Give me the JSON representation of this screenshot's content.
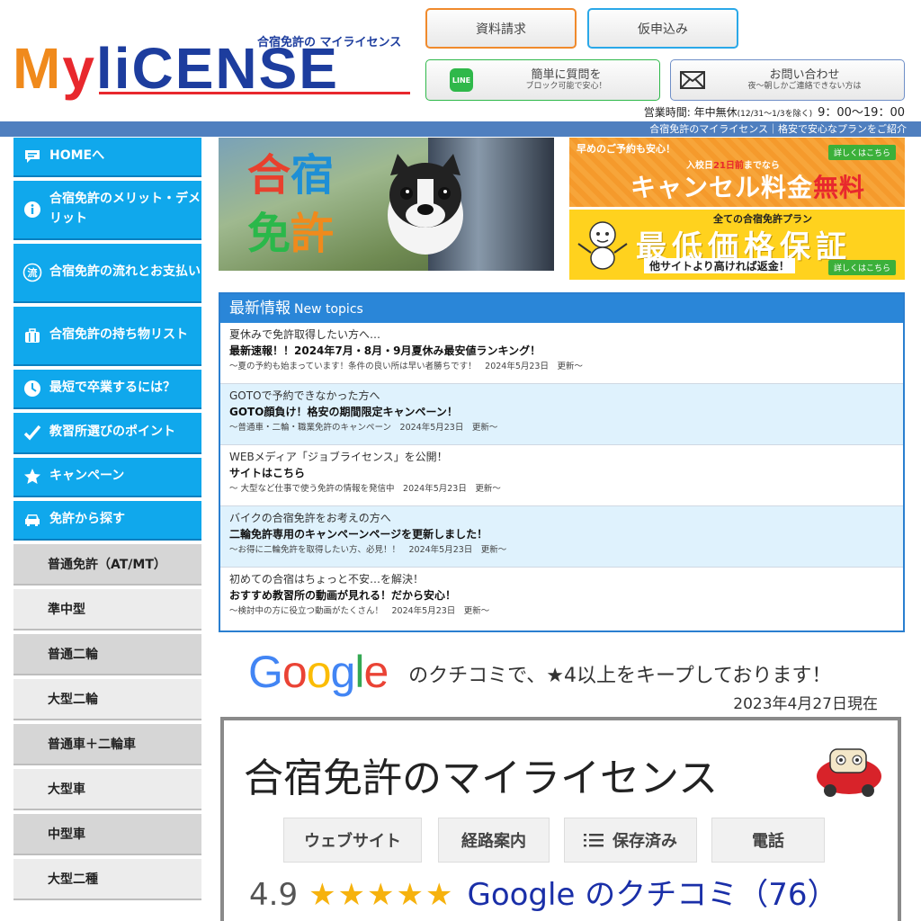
{
  "header": {
    "logo_subtitle": "合宿免許の マイライセンス",
    "logo_m": "M",
    "logo_y": "y",
    "logo_rest": "liCENSE",
    "buttons": {
      "document_request": "資料請求",
      "provisional_apply": "仮申込み",
      "line_main": "簡単に質問を",
      "line_sub": "ブロック可能で安心！",
      "line_icon_text": "LINE",
      "contact_main": "お問い合わせ",
      "contact_sub": "夜～朝しかご連絡できない方は"
    },
    "hours_label": "営業時間: 年中無休",
    "hours_note": "(12/31～1/3を除く)",
    "hours_time": "9：00～19：00",
    "tagline": "合宿免許のマイライセンス｜格安で安心なプランをご紹介"
  },
  "sidebar": {
    "blue_items": [
      {
        "label": "HOMEへ",
        "icon": "speech-bubble-icon"
      },
      {
        "label": "合宿免許のメリット・デメリット",
        "icon": "info-icon"
      },
      {
        "label": "合宿免許の流れとお支払い",
        "icon": "flow-icon",
        "icon_text": "流"
      },
      {
        "label": "合宿免許の持ち物リスト",
        "icon": "suitcase-icon"
      },
      {
        "label": "最短で卒業するには？",
        "icon": "clock-icon"
      },
      {
        "label": "教習所選びのポイント",
        "icon": "check-icon"
      },
      {
        "label": "キャンペーン",
        "icon": "star-icon"
      },
      {
        "label": "免許から探す",
        "icon": "car-icon"
      }
    ],
    "gray_items": [
      "普通免許（AT/MT）",
      "準中型",
      "普通二輪",
      "大型二輪",
      "普通車＋二輪車",
      "大型車",
      "中型車",
      "大型二種"
    ]
  },
  "hero": {
    "line1_a": "合",
    "line1_b": "宿",
    "line2_a": "免",
    "line2_b": "許"
  },
  "banner_cancel": {
    "top": "早めのご予約も安心！",
    "mid_prefix": "入校日",
    "mid_days": "21日前",
    "mid_suffix": "までなら",
    "big": "キャンセル料金",
    "big_accent": "無料",
    "detail": "詳しくはこちら"
  },
  "banner_price": {
    "top": "全ての合宿免許プラン",
    "big": "最低価格保証",
    "sub": "他サイトより高ければ返金！",
    "detail": "詳しくはこちら"
  },
  "topics": {
    "heading": "最新情報",
    "heading_en": "New topics",
    "items": [
      {
        "intro": "夏休みで免許取得したい方へ…",
        "title": "最新速報！！2024年7月・8月・9月夏休み最安値ランキング！",
        "meta": "～夏の予約も始まっています！条件の良い所は早い者勝ちです！　2024年5月23日　更新～"
      },
      {
        "intro": "GOTOで予約できなかった方へ",
        "title": "GOTO顔負け！格安の期間限定キャンペーン！",
        "meta": "～普通車・二輪・職業免許のキャンペーン　2024年5月23日　更新～"
      },
      {
        "intro": "WEBメディア「ジョブライセンス」を公開！",
        "title": "サイトはこちら",
        "meta": "～ 大型など仕事で使う免許の情報を発信中　2024年5月23日　更新～"
      },
      {
        "intro": "バイクの合宿免許をお考えの方へ",
        "title": "二輪免許専用のキャンペーンページを更新しました！",
        "meta": "～お得に二輪免許を取得したい方、必見！！　2024年5月23日　更新～"
      },
      {
        "intro": "初めての合宿はちょっと不安…を解決！",
        "title": "おすすめ教習所の動画が見れる！だから安心！",
        "meta": "～検討中の方に役立つ動画がたくさん！　2024年5月23日　更新～"
      }
    ]
  },
  "google": {
    "logo": [
      "G",
      "o",
      "o",
      "g",
      "l",
      "e"
    ],
    "logo_colors": [
      "#4285f4",
      "#ea4335",
      "#fbbc05",
      "#4285f4",
      "#34a853",
      "#ea4335"
    ],
    "tagline": "のクチコミで、★4以上をキープしております！",
    "date": "2023年4月27日現在",
    "card_title": "合宿免許のマイライセンス",
    "buttons": [
      "ウェブサイト",
      "経路案内",
      "保存済み",
      "電話"
    ],
    "rating": "4.9",
    "stars": "★★★★★",
    "rating_value": 4.9,
    "reviews_label": "Google のクチコミ（76）"
  }
}
